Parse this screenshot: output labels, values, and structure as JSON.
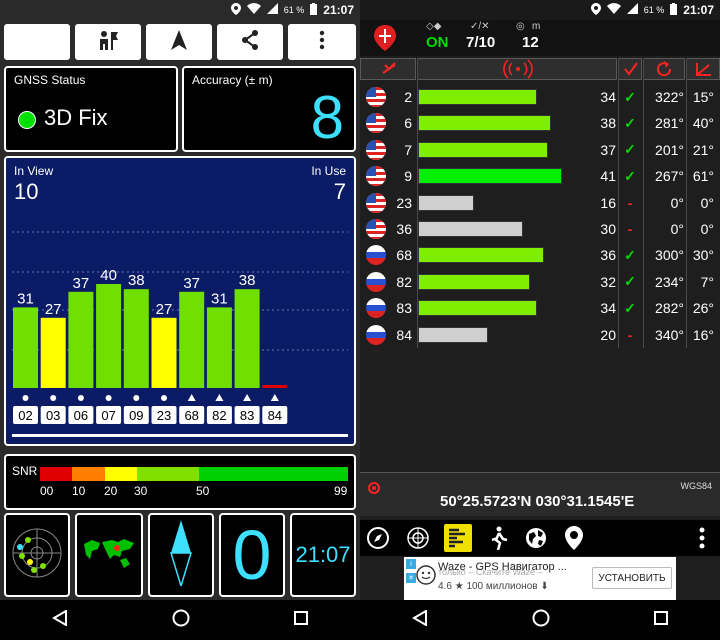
{
  "left_status": {
    "battery": "61 %",
    "time": "21:07"
  },
  "right_status": {
    "battery": "61 %",
    "time": "21:07"
  },
  "left_app": {
    "toolbar": [
      "moon-icon",
      "people-icon",
      "navigation-arrow-icon",
      "share-icon",
      "more-vert-icon"
    ],
    "gnss": {
      "title": "GNSS Status",
      "fix": "3D Fix",
      "fix_color": "#00e000"
    },
    "accuracy": {
      "title": "Accuracy (± m)",
      "value": "8"
    },
    "satellites": {
      "in_view_label": "In View",
      "in_view": "10",
      "in_use_label": "In Use",
      "in_use": "7",
      "chart_data": {
        "type": "bar",
        "categories": [
          "02",
          "03",
          "06",
          "07",
          "09",
          "23",
          "68",
          "82",
          "83",
          "84"
        ],
        "values": [
          31,
          27,
          37,
          40,
          38,
          27,
          37,
          31,
          38,
          0
        ],
        "colors": [
          "#70e000",
          "#ffff00",
          "#70e000",
          "#70e000",
          "#70e000",
          "#ffff00",
          "#70e000",
          "#70e000",
          "#70e000",
          "#dd0000"
        ],
        "markers": [
          "dot",
          "dot",
          "dot",
          "dot",
          "dot",
          "dot",
          "triangle",
          "triangle",
          "triangle",
          "triangle"
        ],
        "value_labels": [
          "31",
          "27",
          "37",
          "40",
          "38",
          "27",
          "37",
          "31",
          "38",
          ""
        ]
      }
    },
    "snr": {
      "label": "SNR",
      "ticks": [
        "00",
        "10",
        "20",
        "30",
        "50",
        "99"
      ]
    },
    "tiles": {
      "zero": "0",
      "time": "21:07"
    }
  },
  "right_app": {
    "header": {
      "status": "ON",
      "used_total": "7/10",
      "accuracy": "12",
      "accuracy_unit": "m"
    },
    "colors": {
      "bar_in_use": "#80ee00",
      "bar_fix": "#00ee00",
      "bar_not_used": "#cfcfcf",
      "check": "#00dd00",
      "dash": "#ff2222",
      "icon_red": "#ff2222"
    },
    "rows": [
      {
        "prn": "2",
        "flag": "us",
        "snr": "34",
        "used": "✓",
        "azimuth": "322°",
        "elevation": "15°",
        "bar": 34,
        "bar_color": "#80ee00"
      },
      {
        "prn": "6",
        "flag": "us",
        "snr": "38",
        "used": "✓",
        "azimuth": "281°",
        "elevation": "40°",
        "bar": 38,
        "bar_color": "#80ee00"
      },
      {
        "prn": "7",
        "flag": "us",
        "snr": "37",
        "used": "✓",
        "azimuth": "201°",
        "elevation": "21°",
        "bar": 37,
        "bar_color": "#80ee00"
      },
      {
        "prn": "9",
        "flag": "us",
        "snr": "41",
        "used": "✓",
        "azimuth": "267°",
        "elevation": "61°",
        "bar": 41,
        "bar_color": "#00ee00"
      },
      {
        "prn": "23",
        "flag": "us",
        "snr": "16",
        "used": "-",
        "azimuth": "0°",
        "elevation": "0°",
        "bar": 16,
        "bar_color": "#cfcfcf"
      },
      {
        "prn": "36",
        "flag": "us",
        "snr": "30",
        "used": "-",
        "azimuth": "0°",
        "elevation": "0°",
        "bar": 30,
        "bar_color": "#cfcfcf"
      },
      {
        "prn": "68",
        "flag": "ru",
        "snr": "36",
        "used": "✓",
        "azimuth": "300°",
        "elevation": "30°",
        "bar": 36,
        "bar_color": "#80ee00"
      },
      {
        "prn": "82",
        "flag": "ru",
        "snr": "32",
        "used": "✓",
        "azimuth": "234°",
        "elevation": "7°",
        "bar": 32,
        "bar_color": "#80ee00"
      },
      {
        "prn": "83",
        "flag": "ru",
        "snr": "34",
        "used": "✓",
        "azimuth": "282°",
        "elevation": "26°",
        "bar": 34,
        "bar_color": "#80ee00"
      },
      {
        "prn": "84",
        "flag": "ru",
        "snr": "20",
        "used": "-",
        "azimuth": "340°",
        "elevation": "16°",
        "bar": 20,
        "bar_color": "#cfcfcf"
      }
    ],
    "coordinates": "50°25.5723'N   030°31.1545'E",
    "datum": "WGS84",
    "toolbar_icons": [
      "compass-icon",
      "radar-icon",
      "signal-bars-icon",
      "walk-icon",
      "globe-icon",
      "map-pin-icon",
      "more-vert-icon"
    ],
    "ad": {
      "title": "Waze - GPS Навигатор ...",
      "subtitle": "только – Скачите Waze –",
      "rating": "4.6",
      "installs": "100 миллионов",
      "button": "УСТАНОВИТЬ"
    }
  }
}
